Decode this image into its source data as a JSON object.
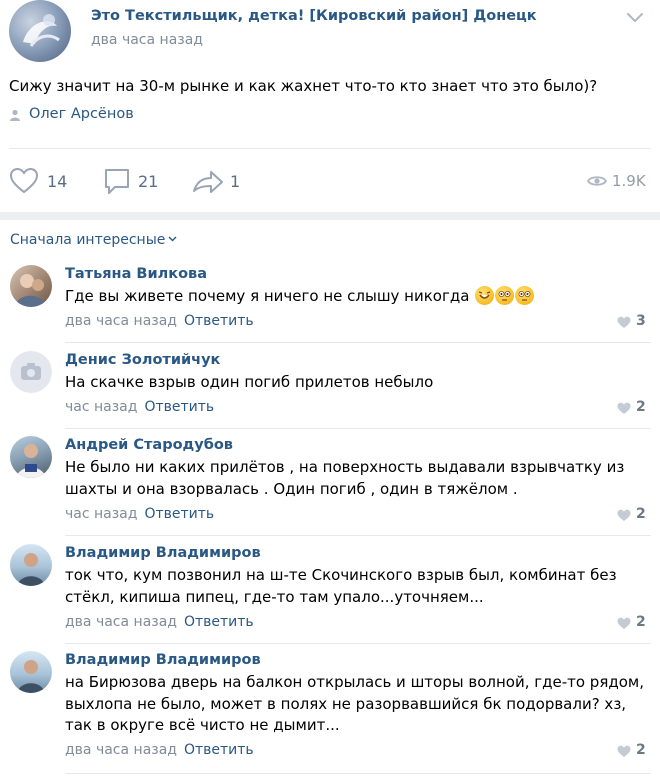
{
  "post": {
    "group_name": "Это Текстильщик, детка! [Кировский район] Донецк",
    "time": "два часа назад",
    "text": "Сижу значит на 30-м рынке и как жахнет что-то кто знает что это было)?",
    "author": "Олег Арсёнов",
    "likes": "14",
    "comments": "21",
    "shares": "1",
    "views": "1.9K"
  },
  "sort_label": "Сначала интересные",
  "comments": [
    {
      "name": "Татьяна Вилкова",
      "text": "Где вы живете почему я ничего не слышу никогда",
      "emoji": [
        "rolling-on-floor-laughing",
        "flushed-face",
        "flushed-face"
      ],
      "time": "два часа назад",
      "reply": "Ответить",
      "likes": "3"
    },
    {
      "name": "Денис Золотийчук",
      "text": "На скачке взрыв один погиб прилетов небыло",
      "time": "час назад",
      "reply": "Ответить",
      "likes": "2"
    },
    {
      "name": "Андрей Стародубов",
      "text": "Не было ни каких прилётов , на поверхность выдавали взрывчатку из шахты и она взорвалась . Один погиб , один в тяжёлом .",
      "time": "час назад",
      "reply": "Ответить",
      "likes": "2"
    },
    {
      "name": "Владимир Владимиров",
      "text": "ток что, кум позвонил на ш-те Скочинского взрыв был, комбинат без стёкл, кипиша пипец, где-то там упало...уточняем...",
      "time": "два часа назад",
      "reply": "Ответить",
      "likes": "2"
    },
    {
      "name": "Владимир Владимиров",
      "text": "на Бирюзова дверь на балкон открылась и шторы волной, где-то рядом, выхлопа не было, может в полях не разорвавшийся бк подорвали? хз, так в округе всё чисто не дымит...",
      "time": "два часа назад",
      "reply": "Ответить",
      "likes": "2"
    }
  ],
  "colors": {
    "link": "#2a5885",
    "meta": "#818c99",
    "action": "#5c6e86",
    "separator": "#e7e8ec",
    "band": "#edeef0"
  }
}
